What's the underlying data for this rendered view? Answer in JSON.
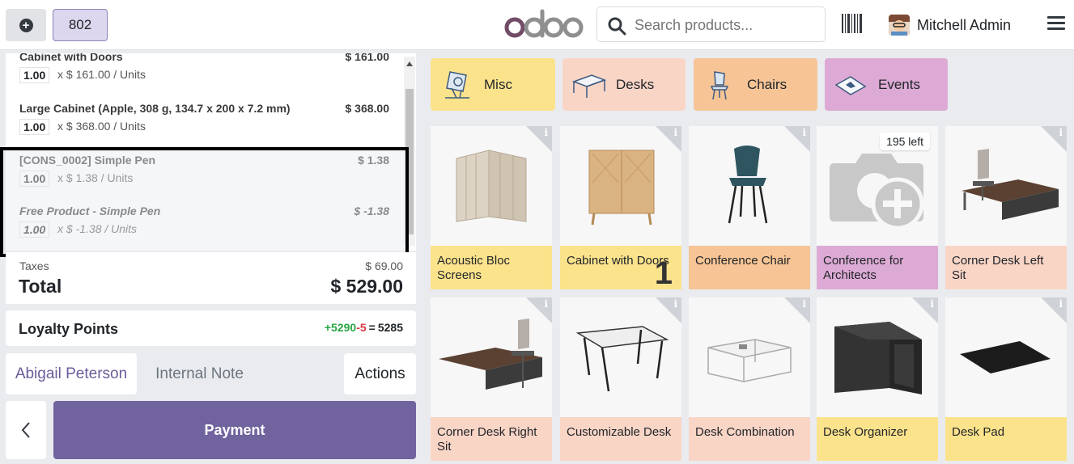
{
  "topbar": {
    "order_number": "802",
    "brand": "odoo",
    "search_placeholder": "Search products...",
    "user_name": "Mitchell Admin"
  },
  "orderlines": [
    {
      "name": "Cabinet with Doors",
      "price": "$ 161.00",
      "qty": "1.00",
      "unit_text": "x $ 161.00 / Units"
    },
    {
      "name": "Large Cabinet (Apple, 308 g, 134.7 x 200 x 7.2 mm)",
      "price": "$ 368.00",
      "qty": "1.00",
      "unit_text": "x $ 368.00 / Units"
    },
    {
      "name": "[CONS_0002] Simple Pen",
      "price": "$ 1.38",
      "qty": "1.00",
      "unit_text": "x $ 1.38 / Units"
    },
    {
      "name": "Free Product - Simple Pen",
      "price": "$ -1.38",
      "qty": "1.00",
      "unit_text": "x $ -1.38 / Units"
    }
  ],
  "totals": {
    "taxes_label": "Taxes",
    "taxes_value": "$ 69.00",
    "total_label": "Total",
    "total_value": "$ 529.00"
  },
  "loyalty": {
    "label": "Loyalty Points",
    "won": "+5290",
    "spent": "-5",
    "equals": "=",
    "balance": "5285"
  },
  "actions": {
    "customer": "Abigail Peterson",
    "internal_note": "Internal Note",
    "actions": "Actions",
    "payment": "Payment"
  },
  "categories": [
    {
      "label": "Misc",
      "color": "#fbe38c",
      "icon": "misc-icon"
    },
    {
      "label": "Desks",
      "color": "#f9d5c6",
      "icon": "desk-icon"
    },
    {
      "label": "Chairs",
      "color": "#f6c495",
      "icon": "chair-icon"
    },
    {
      "label": "Events",
      "color": "#dcaad4",
      "icon": "events-icon"
    }
  ],
  "products": [
    {
      "name": "Acoustic Bloc Screens",
      "color": "#fbe38c"
    },
    {
      "name": "Cabinet with Doors",
      "color": "#fbe38c",
      "qty_in_cart": "1"
    },
    {
      "name": "Conference Chair",
      "color": "#f6c495"
    },
    {
      "name": "Conference for Architects",
      "color": "#dcaad4",
      "stock": "195 left"
    },
    {
      "name": "Corner Desk Left Sit",
      "color": "#f9d5c6"
    },
    {
      "name": "Corner Desk Right Sit",
      "color": "#f9d5c6"
    },
    {
      "name": "Customizable Desk",
      "color": "#f9d5c6"
    },
    {
      "name": "Desk Combination",
      "color": "#f9d5c6"
    },
    {
      "name": "Desk Organizer",
      "color": "#fbe38c"
    },
    {
      "name": "Desk Pad",
      "color": "#fbe38c"
    }
  ]
}
